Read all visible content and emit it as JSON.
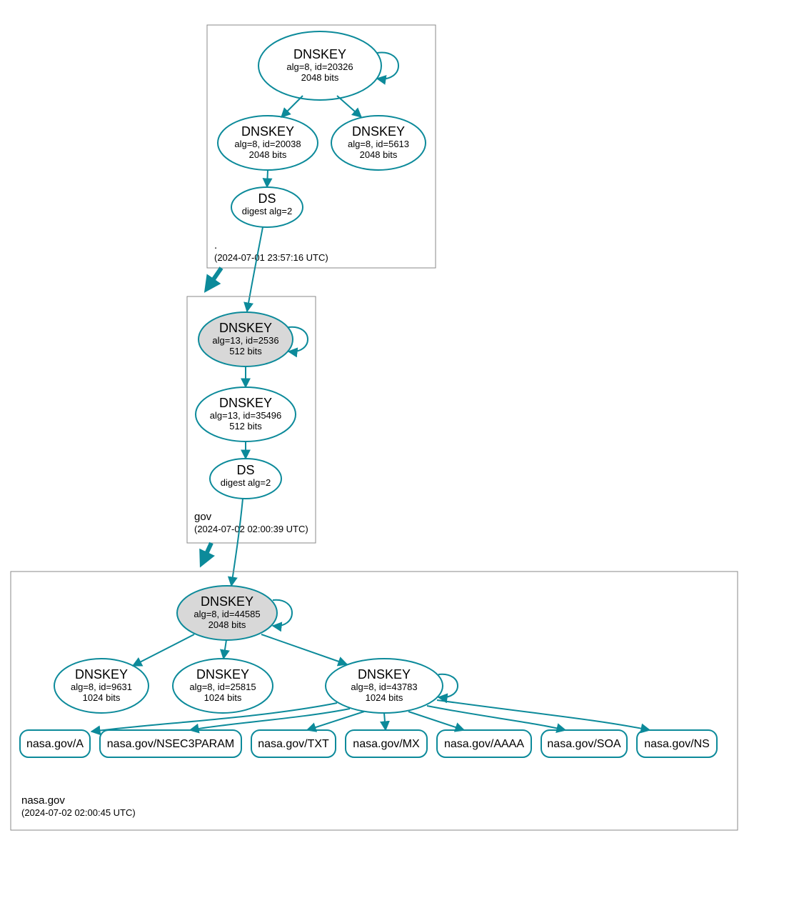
{
  "colors": {
    "edge": "#0c8a9a",
    "ksk_fill": "#d8d8d8",
    "zone_border": "#888888"
  },
  "zones": {
    "root": {
      "label": ".",
      "timestamp": "(2024-07-01 23:57:16 UTC)",
      "nodes": {
        "ksk": {
          "title": "DNSKEY",
          "line1": "alg=8, id=20326",
          "line2": "2048 bits"
        },
        "zsk1": {
          "title": "DNSKEY",
          "line1": "alg=8, id=20038",
          "line2": "2048 bits"
        },
        "zsk2": {
          "title": "DNSKEY",
          "line1": "alg=8, id=5613",
          "line2": "2048 bits"
        },
        "ds": {
          "title": "DS",
          "line1": "digest alg=2"
        }
      }
    },
    "gov": {
      "label": "gov",
      "timestamp": "(2024-07-02 02:00:39 UTC)",
      "nodes": {
        "ksk": {
          "title": "DNSKEY",
          "line1": "alg=13, id=2536",
          "line2": "512 bits"
        },
        "zsk": {
          "title": "DNSKEY",
          "line1": "alg=13, id=35496",
          "line2": "512 bits"
        },
        "ds": {
          "title": "DS",
          "line1": "digest alg=2"
        }
      }
    },
    "nasa": {
      "label": "nasa.gov",
      "timestamp": "(2024-07-02 02:00:45 UTC)",
      "nodes": {
        "ksk": {
          "title": "DNSKEY",
          "line1": "alg=8, id=44585",
          "line2": "2048 bits"
        },
        "zsk1": {
          "title": "DNSKEY",
          "line1": "alg=8, id=9631",
          "line2": "1024 bits"
        },
        "zsk2": {
          "title": "DNSKEY",
          "line1": "alg=8, id=25815",
          "line2": "1024 bits"
        },
        "zsk3": {
          "title": "DNSKEY",
          "line1": "alg=8, id=43783",
          "line2": "1024 bits"
        }
      },
      "rrsets": {
        "a": "nasa.gov/A",
        "nsec3param": "nasa.gov/NSEC3PARAM",
        "txt": "nasa.gov/TXT",
        "mx": "nasa.gov/MX",
        "aaaa": "nasa.gov/AAAA",
        "soa": "nasa.gov/SOA",
        "ns": "nasa.gov/NS"
      }
    }
  }
}
